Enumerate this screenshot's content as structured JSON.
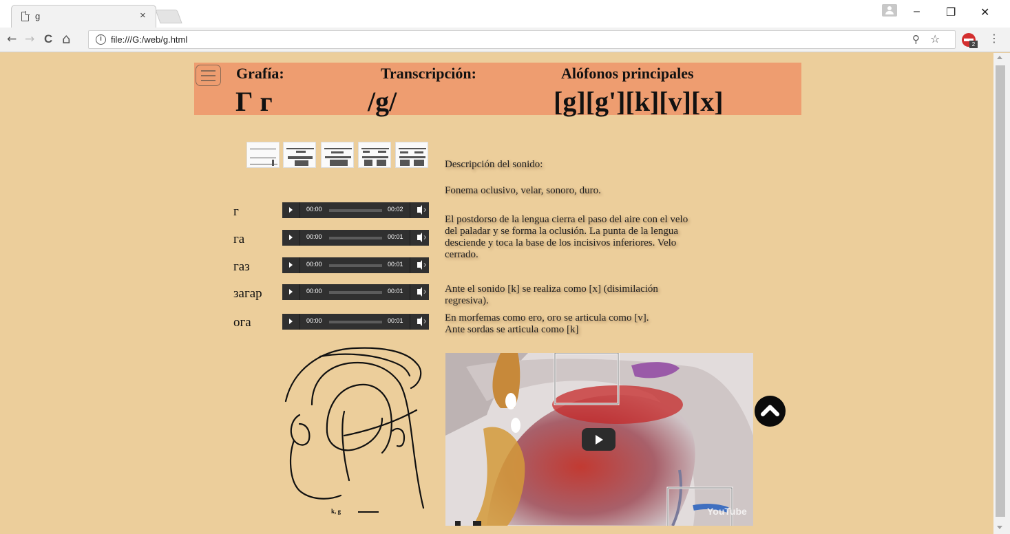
{
  "browser": {
    "tab_title": "g",
    "tab_close": "×",
    "url": "file:///G:/web/g.html",
    "window_controls": {
      "minimize": "–",
      "restore": "❐",
      "close": "✕"
    },
    "nav": {
      "back": "←",
      "forward": "→",
      "reload": "C",
      "home": "⌂"
    },
    "extension_badge": "2",
    "icons": [
      "page-icon",
      "info-icon",
      "zoom-icon",
      "star-icon",
      "menu-icon"
    ]
  },
  "header": {
    "grafia_label": "Grafía:",
    "grafia_value": "Г г",
    "transcripcion_label": "Transcripción:",
    "transcripcion_value": "/g/",
    "alofonos_label": "Alófonos principales",
    "alofonos_value": "[g][g'][k][v][x]",
    "background": "#ee9d70"
  },
  "spectrograms": {
    "count": 5
  },
  "audio_rows": [
    {
      "word": "г",
      "current": "00:00",
      "duration": "00:02"
    },
    {
      "word": "га",
      "current": "00:00",
      "duration": "00:01"
    },
    {
      "word": "газ",
      "current": "00:00",
      "duration": "00:01"
    },
    {
      "word": "загар",
      "current": "00:00",
      "duration": "00:01"
    },
    {
      "word": "ога",
      "current": "00:00",
      "duration": "00:01"
    }
  ],
  "description": {
    "heading": "Descripción del sonido:",
    "type": "Fonema oclusivo, velar, sonoro, duro.",
    "articulation_lines": [
      "El postdorso de la lengua cierra el paso del aire con el velo",
      "del paladar y se forma la oclusión. La punta de la lengua",
      "desciende y toca la base de los incisivos inferiores. Velo",
      "cerrado."
    ],
    "notes_lines": [
      "Ante el sonido [k] se realiza como [x] (disimilación",
      "regresiva).",
      "En morfemas como его, ого se articula como [v].",
      "Ante sordas se articula como [k]"
    ]
  },
  "diagram": {
    "label": "k, g"
  },
  "video": {
    "logo": "YouTube"
  },
  "colors": {
    "page_bg": "#ecce9b",
    "player_bg": "#303030"
  }
}
